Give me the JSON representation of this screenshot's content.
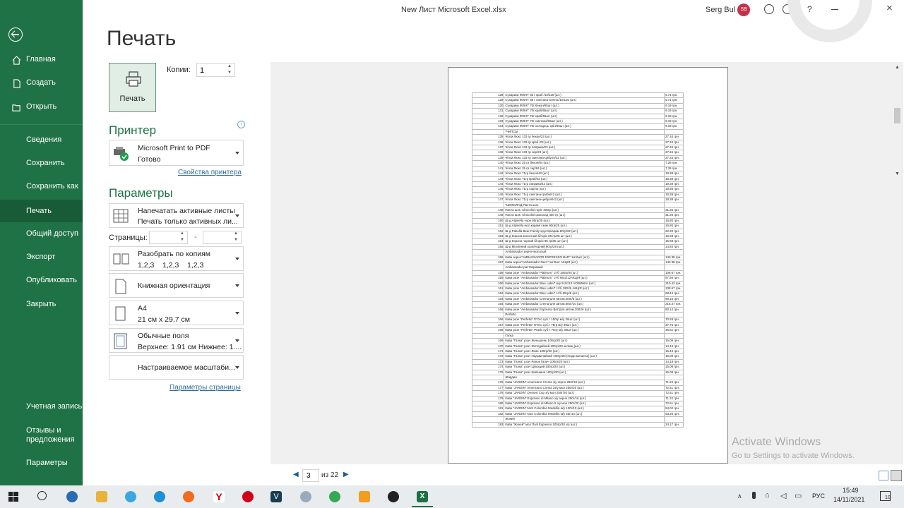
{
  "window": {
    "title": "New Лист Microsoft Excel.xlsx",
    "user": "Serg Bul",
    "user_initials": "SB"
  },
  "nav": {
    "items": [
      "Главная",
      "Создать",
      "Открыть",
      "Сведения",
      "Сохранить",
      "Сохранить как",
      "Печать",
      "Общий доступ",
      "Экспорт",
      "Опубликовать",
      "Закрыть"
    ],
    "bottom_items": [
      "Учетная запись",
      "Отзывы и",
      "предложения",
      "Параметры"
    ]
  },
  "print": {
    "title": "Печать",
    "button_label": "Печать",
    "copies_label": "Копии:",
    "copies_value": "1",
    "printer_heading": "Принтер",
    "printer_name": "Microsoft Print to PDF",
    "printer_status": "Готово",
    "printer_props_link": "Свойства принтера",
    "params_heading": "Параметры",
    "pages_label": "Страницы:",
    "pages_sep": "-",
    "page_setup_link": "Параметры страницы"
  },
  "settings": [
    {
      "line1": "Напечатать активные листы",
      "line2": "Печать только активных ли..."
    },
    {
      "line1": "Разобрать по копиям",
      "line2": "1,2,3    1,2,3    1,2,3"
    },
    {
      "line1": "Книжная ориентация",
      "line2": ""
    },
    {
      "line1": "А4",
      "line2": "21 см x 29.7 см"
    },
    {
      "line1": "Обычные поля",
      "line2": "Верхнее: 1.91 см Нижнее: 1...."
    },
    {
      "line1": "Настраиваемое масштаби...",
      "line2": ""
    }
  ],
  "pager": {
    "current": "3",
    "total_label": "из 22"
  },
  "watermark": {
    "line1": "Activate Windows",
    "line2": "Go to Settings to activate Windows."
  },
  "taskbar": {
    "lang": "РУС",
    "time": "15:49",
    "date": "14/11/2021",
    "notif": "10"
  },
  "preview_rows": [
    [
      "128",
      "Сухарики ФЛІНТ 35 г краб /10/120 (шт.)",
      "5.71 грн."
    ],
    [
      "129",
      "Сухарики ФЛІНТ 35 г сметана-зелень/10/120 (шт.)",
      "5.71 грн."
    ],
    [
      "130",
      "Сухарики ФЛІНТ 70г бекон/65шт (шт.)",
      "9.19 грн."
    ],
    [
      "131",
      "Сухарики ФЛІНТ 70г краб/65шт (шт.)",
      "9.19 грн."
    ],
    [
      "132",
      "Сухарики ФЛІНТ 70г краб/65шт (шт.)",
      "9.19 грн."
    ],
    [
      "133",
      "Сухарики ФЛІНТ 70г сметана/65шт (шт.)",
      "9.19 грн."
    ],
    [
      "134",
      "Сухарики ФЛІНТ 70г холодець-хрін/65шт (шт.)",
      "9.19 грн."
    ],
    [
      "",
      "*ЧИПСЫ",
      ""
    ],
    [
      "135",
      "Чіпси Люкс 133 гр бекон/23 (шт.)",
      "27.34 грн."
    ],
    [
      "136",
      "Чіпси Люкс 133 гр краб /23 (шт.)",
      "27.34 грн."
    ],
    [
      "137",
      "Чіпси Люкс 133 гр паприка/23 (шт.)",
      "27.34 грн."
    ],
    [
      "138",
      "Чіпси Люкс 133 гр сир/23 (шт.)",
      "27.34 грн."
    ],
    [
      "139",
      "Чіпси Люкс 133 гр сметана-цибуля/23 (шт.)",
      "27.34 грн."
    ],
    [
      "140",
      "Чіпси Люкс 25 гр бекон/84 (шт.)",
      "7.26 грн."
    ],
    [
      "141",
      "Чіпси Люкс 25 гр сир/84 (шт.)",
      "7.26 грн."
    ],
    [
      "142",
      "Чіпси Люкс 71гр бекон/42 (шт.)",
      "18.38 грн."
    ],
    [
      "143",
      "Чіпси Люкс 71гр краб/42 (шт.)",
      "18.38 грн."
    ],
    [
      "144",
      "Чіпси Люкс 71гр паприка/42 (шт.)",
      "18.38 грн."
    ],
    [
      "145",
      "Чіпси Люкс 71гр сир/42 (шт.)",
      "18.38 грн."
    ],
    [
      "146",
      "Чіпси Люкс 71гр сметана-гриби/42 (шт.)",
      "18.38 грн."
    ],
    [
      "147",
      "Чіпси Люкс 71гр сметана-цибуля/42 (шт.)",
      "18.38 грн."
    ],
    [
      "",
      "*ШОКОЛАД,Паста шок.",
      ""
    ],
    [
      "148",
      "Паста шок. Chocolini горіх 400гр (шт.)",
      "31.25 грн."
    ],
    [
      "149",
      "Паста шок. Chocolini шоколад 400 гр (шт.)",
      "31.25 грн."
    ],
    [
      "150",
      "Ш-д Alpinella чорн 90гр/25 (шт.)",
      "16.80 грн."
    ],
    [
      "151",
      "Ш-д Alpinella мол.карам/ смак 90гр/25 (шт.)",
      "16.80 грн."
    ],
    [
      "152",
      "Ш-д Pabellа Bear Family хрустк/карам 80гр/22 (шт.)",
      "22.20 грн."
    ],
    [
      "153",
      "Ш-д Корона молочний б/горіх 85 гр/25 шт (шт.)",
      "16.68 грн."
    ],
    [
      "154",
      "Ш-д Корона чорний б/горіх 85 гр/25 шт (шт.)",
      "16.68 грн."
    ],
    [
      "155",
      "Ш-д Міллінний горіх/чорний 90гр/28 (шт.)",
      "14.84 грн."
    ],
    [
      "",
      "Ambassador зерно+молотый",
      ""
    ],
    [
      "156",
      "Кава зерно\"AMBASSADOR EXPRESSO BAR\" 1кг/6шт (шт.)",
      "143.38 грн."
    ],
    [
      "157",
      "Кава зерно\"Ambassador Nero\" 1кг/6шт АКЦІЯ (шт.)",
      "143.38 грн."
    ],
    [
      "",
      "Ambassador растворимый",
      ""
    ],
    [
      "158",
      "Кава розч \"Ambassador Platinum\" ст/б 190гр/6 (шт.)",
      "108.67 грн."
    ],
    [
      "159",
      "Кава розч \"Ambassador Platinum\" ст/б 95гр/12АКЦІЯ (шт.)",
      "67.56 грн."
    ],
    [
      "160",
      "Кава розч \"Ambassador Blue Label\" м/у 510г/10 НОВИНКА (шт.)",
      "210.42 грн."
    ],
    [
      "161",
      "Кава розч \"Ambassador Blue Label\" ст/б 190г/6 АКЦІЯ (шт.)",
      "108.67 грн."
    ],
    [
      "162",
      "Кава розч \"Ambassador Blue Label\" ст/б 95гр/6 (шт.)",
      "68.44 грн."
    ],
    [
      "163",
      "Кава розч \"Ambassador Crema\"для автом.200г/6 (шт.)",
      "90.16 грн."
    ],
    [
      "164",
      "Кава розч \"Ambassador Crema\"для автом.500г/10 (шт.)",
      "216.37 грн."
    ],
    [
      "165",
      "Кава розч \"Ambassador Espresso Bar\"для автом.200г/6 (шт.)",
      "90.14 грн."
    ],
    [
      "",
      "Perfetto",
      ""
    ],
    [
      "166",
      "Кава розч \"Perfetto\" D'Oro суб.т 150гр м/у 20шт (шт.)",
      "70.93 грн."
    ],
    [
      "167",
      "Кава розч \"Perfetto\" D'Oro суб.т 75гр м/у 30шт (шт.)",
      "37.75 грн."
    ],
    [
      "168",
      "Кава розч \"Perfetto\" Prado суб.т 75гр м/у 30шт (шт.)",
      "36.61 грн."
    ],
    [
      "",
      "Галка",
      ""
    ],
    [
      "169",
      "Кава \"Галка\" розч Женьшень 100гр/20 (шт.)",
      "15.09 грн."
    ],
    [
      "170",
      "Кава \"Галка\" розч Житедайний 100гр/20 зелмщ (шт.)",
      "14.19 грн."
    ],
    [
      "171",
      "Кава \"Галка\" розч Люкс 100гр/20 (шт.)",
      "16.43 грн."
    ],
    [
      "172",
      "Кава \"Галка\" розч Надзвичайний 100гр/20 (ягоди мелисса) (шт.)",
      "15.09 грн."
    ],
    [
      "173",
      "Кава \"Галка\" розч Ранок Галич 100гр/20 (шт.)",
      "14.18 грн."
    ],
    [
      "174",
      "Кава \"Галка\" розч Цілющий 100гр/20 (шт.)",
      "15.09 грн."
    ],
    [
      "175",
      "Кава \"Галка\" розч Шипшина 100гр/20 (шт.)",
      "15.09 грн."
    ],
    [
      "",
      "Жардин",
      ""
    ],
    [
      "176",
      "Кава \"JARDIN\" Americano Crema з/у зерно 250г/16 (шт.)",
      "71.22 грн."
    ],
    [
      "177",
      "Кава \"JARDIN\" Americano Crema 3з/у мол 250г/20 (шт.)",
      "72.51 грн."
    ],
    [
      "178",
      "Кава \"JARDIN\" Dessert Cup з/у мол 250г/20 (шт.)",
      "72.51 грн."
    ],
    [
      "179",
      "Кава \"JARDIN\" Espresso di Milano з/у зерно 250г/16 (шт.)",
      "71.22 грн."
    ],
    [
      "180",
      "Кава \"JARDIN\" Espresso di Milano 5 з/у мол 250г/20 (шт.)",
      "72.51 грн."
    ],
    [
      "181",
      "Кава \"JARDIN\" NoS Colombia Medellin м/у 130г/10 (шт.)",
      "94.02 грн."
    ],
    [
      "182",
      "Кава \"JARDIN\" NoS Colombia Medellin м/у 65г/14 (шт.)",
      "53.20 грн."
    ],
    [
      "",
      "Жокей",
      ""
    ],
    [
      "183",
      "Кава \"Жокей\" мол Пазl Espresso 100гр/20 з/у (шт.)",
      "24.17 грн."
    ]
  ]
}
